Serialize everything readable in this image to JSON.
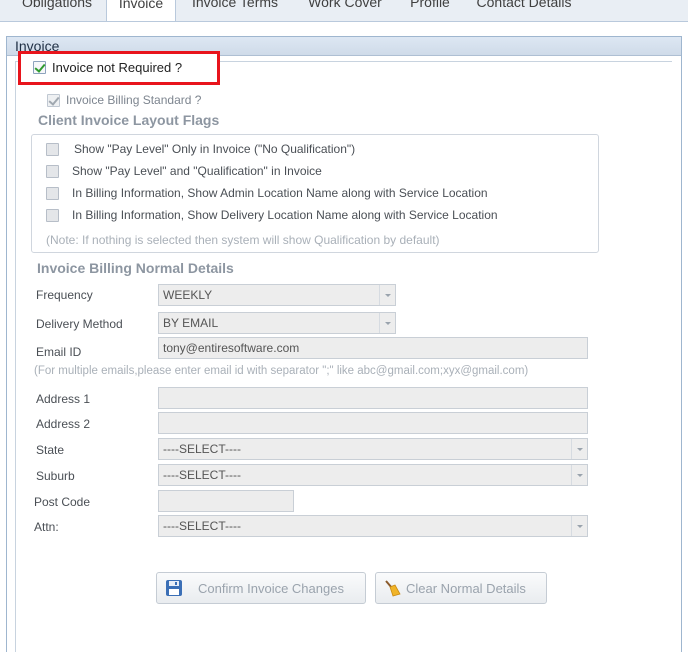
{
  "tabs": [
    "Obligations",
    "Invoice",
    "Invoice Terms",
    "Work Cover",
    "Profile",
    "Contact Details"
  ],
  "panel_title": "Invoice",
  "invoice_not_required": {
    "label": "Invoice not Required ?",
    "checked": true
  },
  "billing_standard": {
    "label": "Invoice Billing Standard ?",
    "checked": true
  },
  "layout_flags": {
    "title": "Client Invoice Layout Flags",
    "options": [
      "Show \"Pay Level\" Only in Invoice (\"No Qualification\")",
      "Show \"Pay Level\" and \"Qualification\" in Invoice",
      "In Billing Information, Show Admin Location Name along with Service Location",
      "In Billing Information, Show Delivery Location Name along with Service Location"
    ],
    "note": "(Note: If nothing is selected then system will show Qualification by default)"
  },
  "billing": {
    "title": "Invoice Billing Normal Details",
    "frequency_label": "Frequency",
    "frequency_value": "WEEKLY",
    "delivery_label": "Delivery Method",
    "delivery_value": "BY EMAIL",
    "email_label": "Email ID",
    "email_value": "tony@entiresoftware.com",
    "email_hint": "(For multiple emails,please enter email id with separator \";\" like abc@gmail.com;xyx@gmail.com)",
    "address1_label": "Address 1",
    "address1_value": "",
    "address2_label": "Address 2",
    "address2_value": "",
    "state_label": "State",
    "state_value": "----SELECT----",
    "suburb_label": "Suburb",
    "suburb_value": "----SELECT----",
    "postcode_label": "Post Code",
    "postcode_value": "",
    "attn_label": "Attn:",
    "attn_value": "----SELECT----"
  },
  "buttons": {
    "confirm": "Confirm Invoice Changes",
    "clear": "Clear Normal Details"
  },
  "icons": {
    "save": "floppy-disk-icon",
    "clear": "broom-icon"
  },
  "colors": {
    "highlight": "#e8141c",
    "check": "#2f9a2f"
  }
}
